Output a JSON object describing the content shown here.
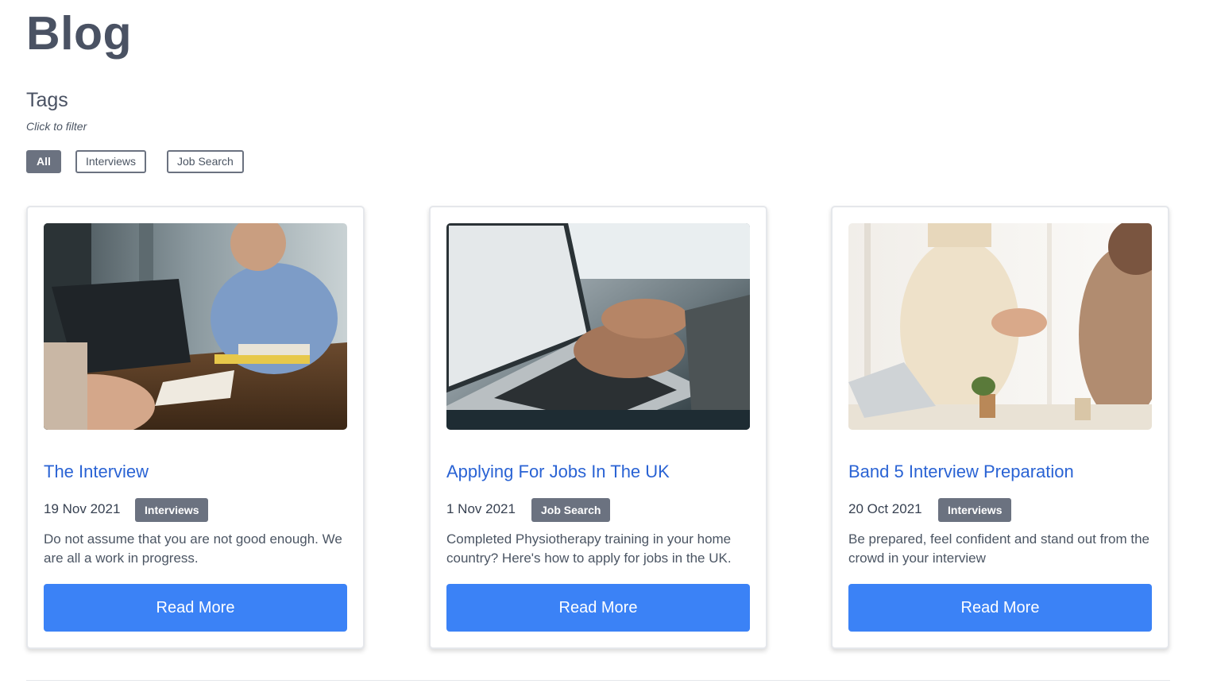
{
  "page": {
    "title": "Blog"
  },
  "tags": {
    "heading": "Tags",
    "hint": "Click to filter",
    "filters": [
      {
        "label": "All",
        "active": true
      },
      {
        "label": "Interviews",
        "active": false
      },
      {
        "label": "Job Search",
        "active": false
      }
    ]
  },
  "posts": [
    {
      "title": "The Interview",
      "date": "19 Nov 2021",
      "tag": "Interviews",
      "excerpt": "Do not assume that you are not good enough. We are all a work in progress.",
      "button": "Read More",
      "image": "interview-meeting-photo"
    },
    {
      "title": "Applying For Jobs In The UK",
      "date": "1 Nov 2021",
      "tag": "Job Search",
      "excerpt": "Completed Physiotherapy training in your home country? Here's how to apply for jobs in the UK.",
      "button": "Read More",
      "image": "laptop-typing-photo"
    },
    {
      "title": "Band 5 Interview Preparation",
      "date": "20 Oct 2021",
      "tag": "Interviews",
      "excerpt": "Be prepared, feel confident and stand out from the crowd in your interview",
      "button": "Read More",
      "image": "handshake-photo"
    }
  ],
  "colors": {
    "title_link": "#2a63d4",
    "button": "#3b82f6",
    "tag": "#6b7280",
    "heading": "#4a5263"
  }
}
